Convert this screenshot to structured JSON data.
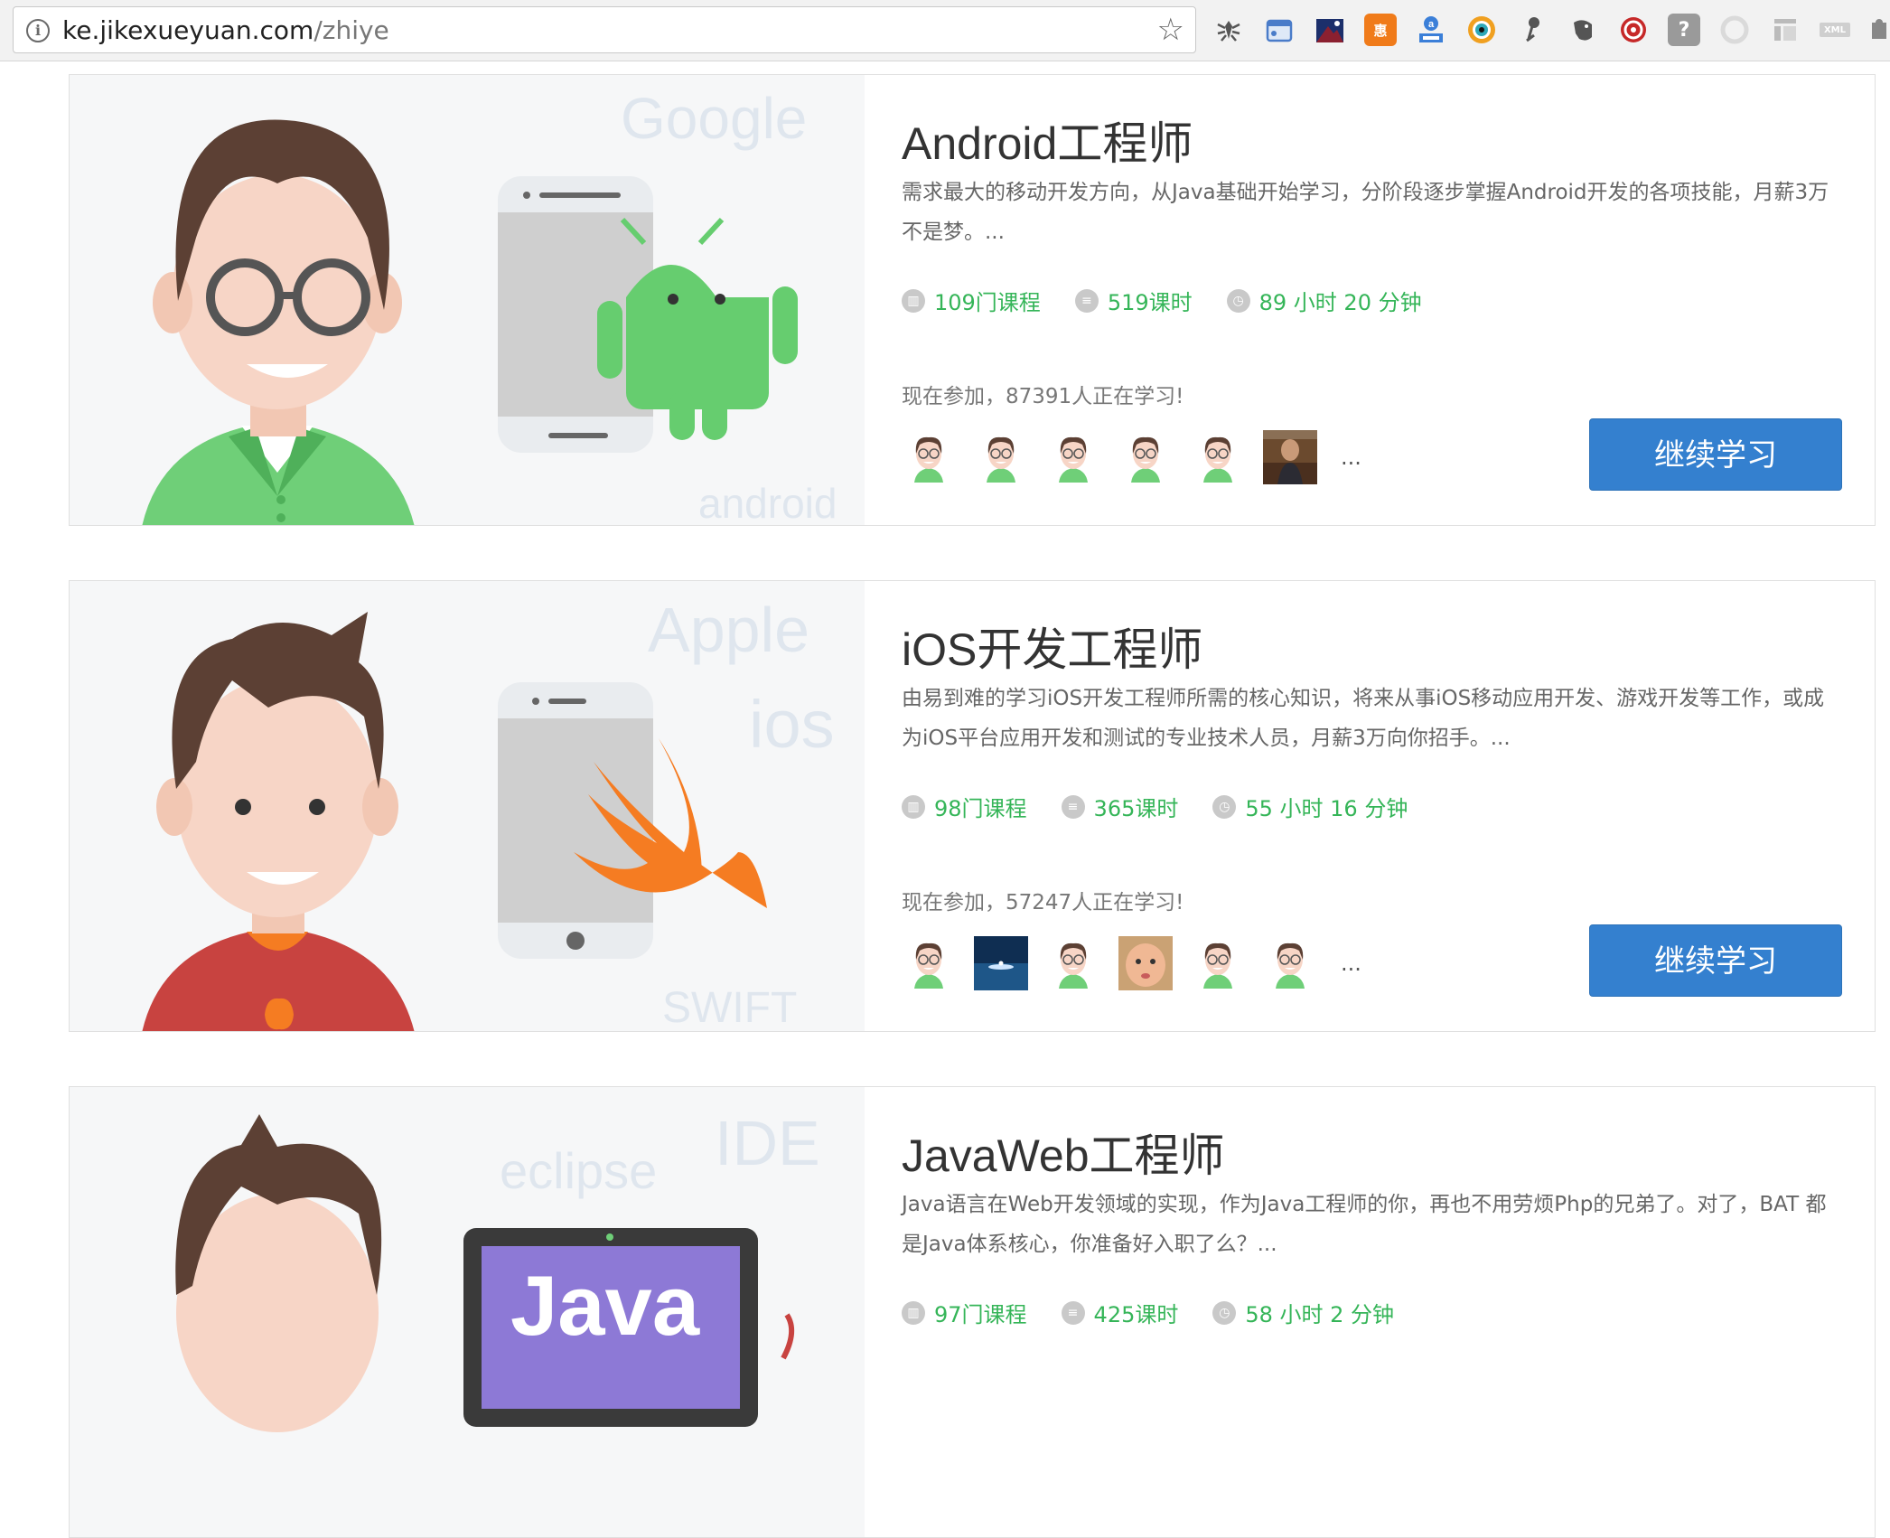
{
  "browser": {
    "url_host": "ke.jikexueyuan.com",
    "url_path": "/zhiye",
    "extensions": [
      "bug-icon",
      "window-icon",
      "space-icon",
      "hui-icon",
      "translate-icon",
      "eye-icon",
      "pin-icon",
      "elephant-icon",
      "record-icon",
      "question-icon",
      "circle-icon",
      "columns-icon",
      "xml-icon",
      "puzzle-icon"
    ],
    "ext_labels": {
      "hui": "惠",
      "question": "?",
      "xml": "XML"
    }
  },
  "cards": [
    {
      "title": "Android工程师",
      "desc": "需求最大的移动开发方向，从Java基础开始学习，分阶段逐步掌握Android开发的各项技能，月薪3万不是梦。...",
      "courses": "109门课程",
      "lessons": "519课时",
      "duration": "89 小时 20 分钟",
      "joined": "现在参加，87391人正在学习!",
      "button": "继续学习",
      "hero_words": [
        "Google",
        "android"
      ]
    },
    {
      "title": "iOS开发工程师",
      "desc": "由易到难的学习iOS开发工程师所需的核心知识，将来从事iOS移动应用开发、游戏开发等工作，或成为iOS平台应用开发和测试的专业技术人员，月薪3万向你招手。...",
      "courses": "98门课程",
      "lessons": "365课时",
      "duration": "55 小时 16 分钟",
      "joined": "现在参加，57247人正在学习!",
      "button": "继续学习",
      "hero_words": [
        "Apple",
        "ios",
        "SWIFT"
      ]
    },
    {
      "title": "JavaWeb工程师",
      "desc": "Java语言在Web开发领域的实现，作为Java工程师的你，再也不用劳烦Php的兄弟了。对了，BAT 都是Java体系核心，你准备好入职了么？...",
      "courses": "97门课程",
      "lessons": "425课时",
      "duration": "58 小时 2 分钟",
      "hero_words": [
        "IDE",
        "eclipse",
        "Java"
      ]
    }
  ],
  "more": "..."
}
